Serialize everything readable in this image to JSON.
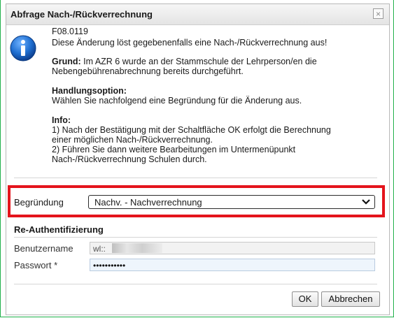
{
  "dialog": {
    "title": "Abfrage Nach-/Rückverrechnung",
    "close_symbol": "×"
  },
  "message": {
    "code": "F08.0119",
    "intro": "Diese Änderung löst gegebenenfalls eine Nach-/Rückverrechnung aus!",
    "grund_label": "Grund:",
    "grund_line1": "Im AZR 6 wurde an der Stammschule der Lehrperson/en die",
    "grund_line2": "Nebengebührenabrechnung bereits durchgeführt.",
    "handlung_label": "Handlungsoption:",
    "handlung_text": "Wählen Sie nachfolgend eine Begründung für die Änderung aus.",
    "info_label": "Info:",
    "info_line1": "1) Nach der Bestätigung mit der Schaltfläche OK erfolgt die Berechnung",
    "info_line2": "einer möglichen Nach-/Rückverrechnung.",
    "info_line3": "2) Führen Sie dann weitere Bearbeitungen im Untermenüpunkt",
    "info_line4": "Nach-/Rückverrechnung Schulen durch."
  },
  "begruendung": {
    "label": "Begründung",
    "selected": "Nachv. - Nachverrechnung"
  },
  "reauth": {
    "title": "Re-Authentifizierung",
    "username_label": "Benutzername",
    "username_value": "wl::",
    "password_label": "Passwort *",
    "password_value": "•••••••••••"
  },
  "buttons": {
    "ok": "OK",
    "cancel": "Abbrechen"
  },
  "icons": [
    "info-icon",
    "close-icon",
    "chevron-down-icon"
  ],
  "colors": {
    "highlight": "#e4141c",
    "frame": "#22b14c",
    "info_blue": "#1565c0"
  }
}
